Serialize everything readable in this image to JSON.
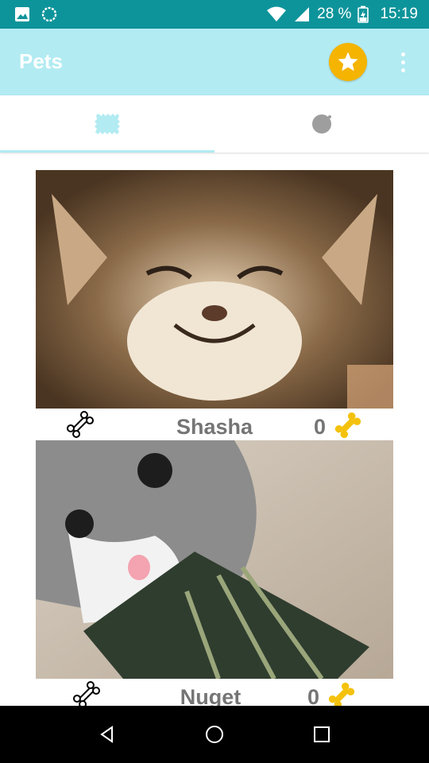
{
  "status_bar": {
    "battery": "28 %",
    "time": "15:19",
    "icons": [
      "image-icon",
      "circle-notification-icon",
      "wifi-icon",
      "cell-signal-icon",
      "battery-charging-icon"
    ]
  },
  "app_bar": {
    "title": "Pets",
    "actions": [
      "star-icon",
      "more-vert-icon"
    ],
    "background": "#b2ebf2",
    "star_color": "#f4b400"
  },
  "tabs": [
    {
      "icon": "bone-pattern-icon",
      "selected": true
    },
    {
      "icon": "paw-icon",
      "selected": false
    }
  ],
  "pets": [
    {
      "name": "Shasha",
      "count": "0"
    },
    {
      "name": "Nuget",
      "count": "0"
    }
  ],
  "nav_bar": {
    "buttons": [
      "back-icon",
      "home-icon",
      "recents-icon"
    ]
  }
}
